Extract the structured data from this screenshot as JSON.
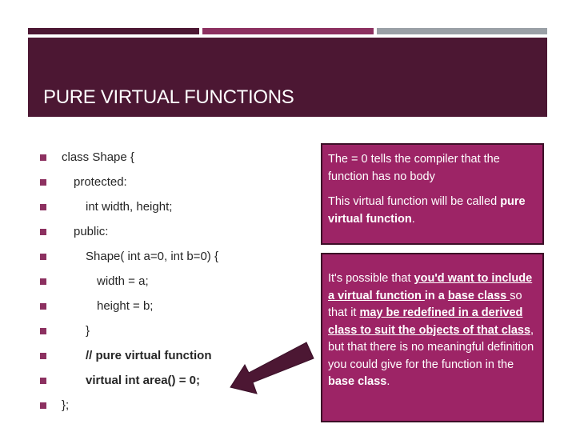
{
  "slide": {
    "title": "PURE VIRTUAL FUNCTIONS",
    "colors": {
      "header": "#4c1733",
      "accent_bar_1": "#4c1733",
      "accent_bar_2": "#8c3060",
      "accent_bar_3": "#9aa0a6",
      "bullet": "#8c3060",
      "callout_fill": "#9d2466",
      "arrow": "#4c1733"
    }
  },
  "code_lines": [
    {
      "text": "class Shape {",
      "indent": 0,
      "bold": false
    },
    {
      "text": "protected:",
      "indent": 1,
      "bold": false
    },
    {
      "text": "int width, height;",
      "indent": 2,
      "bold": false
    },
    {
      "text": "public:",
      "indent": 1,
      "bold": false
    },
    {
      "text": "Shape( int a=0, int b=0) {",
      "indent": 2,
      "bold": false
    },
    {
      "text": "width = a;",
      "indent": 3,
      "bold": false
    },
    {
      "text": "height = b;",
      "indent": 3,
      "bold": false
    },
    {
      "text": "}",
      "indent": 2,
      "bold": false
    },
    {
      "text": "// pure virtual function",
      "indent": 2,
      "bold": true
    },
    {
      "text": "virtual int area() = 0;",
      "indent": 2,
      "bold": true
    },
    {
      "text": "};",
      "indent": 0,
      "bold": false
    }
  ],
  "callout1": {
    "p1": "The = 0 tells the compiler that the function has no body",
    "p2_prefix": "This virtual function will be called ",
    "p2_bold": "pure virtual function",
    "p2_suffix": "."
  },
  "callout2": {
    "s1": "It's possible that ",
    "s2": "you'd want to include a virtual function ",
    "s3": "in a ",
    "s4": "base class ",
    "s5": "so that it ",
    "s6": "may be redefined in a derived class to suit the objects of that class",
    "s7": ", but that there is no meaningful definition you could give for the function in the ",
    "s8": "base class",
    "s9": "."
  },
  "arrow": {
    "icon": "arrow-pointing-down-left",
    "points_to": "virtual int area() = 0;"
  }
}
